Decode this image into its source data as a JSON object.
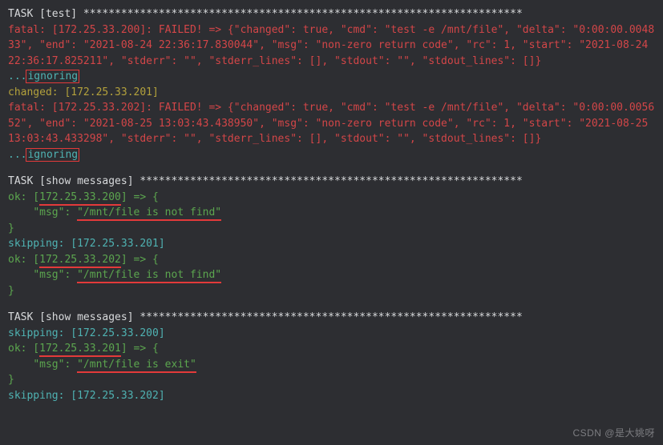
{
  "task1": {
    "header": "TASK [test] **********************************************************************",
    "fatal_a": "fatal: [172.25.33.200]: FAILED! => {\"changed\": true, \"cmd\": \"test -e /mnt/file\", \"delta\": \"0:00:00.004833\", \"end\": \"2021-08-24 22:36:17.830044\", \"msg\": \"non-zero return code\", \"rc\": 1, \"start\": \"2021-08-24 22:36:17.825211\", \"stderr\": \"\", \"stderr_lines\": [], \"stdout\": \"\", \"stdout_lines\": []}",
    "ignore_dots": "...",
    "ignore_word": "ignoring",
    "changed": "changed: [172.25.33.201]",
    "fatal_b": "fatal: [172.25.33.202]: FAILED! => {\"changed\": true, \"cmd\": \"test -e /mnt/file\", \"delta\": \"0:00:00.005652\", \"end\": \"2021-08-25 13:03:43.438950\", \"msg\": \"non-zero return code\", \"rc\": 1, \"start\": \"2021-08-25 13:03:43.433298\", \"stderr\": \"\", \"stderr_lines\": [], \"stdout\": \"\", \"stdout_lines\": []}"
  },
  "task2": {
    "header": "TASK [show messages] *************************************************************",
    "ok1_pre": "ok: [",
    "ok1_ip": "172.25.33.200",
    "ok1_post": "] => {",
    "msg_key": "    \"msg\": ",
    "msg1_val": "\"/mnt/file is not find\"",
    "brace": "}",
    "skip": "skipping: [172.25.33.201]",
    "ok2_pre": "ok: [",
    "ok2_ip": "172.25.33.202",
    "ok2_post": "] => {",
    "msg2_val": "\"/mnt/file is not find\""
  },
  "task3": {
    "header": "TASK [show messages] *************************************************************",
    "skip1": "skipping: [172.25.33.200]",
    "ok_pre": "ok: [",
    "ok_ip": "172.25.33.201",
    "ok_post": "] => {",
    "msg_key": "    \"msg\": ",
    "msg_val": "\"/mnt/file is exit\"",
    "brace": "}",
    "skip2": "skipping: [172.25.33.202]"
  },
  "watermark": "CSDN @是大姚呀"
}
